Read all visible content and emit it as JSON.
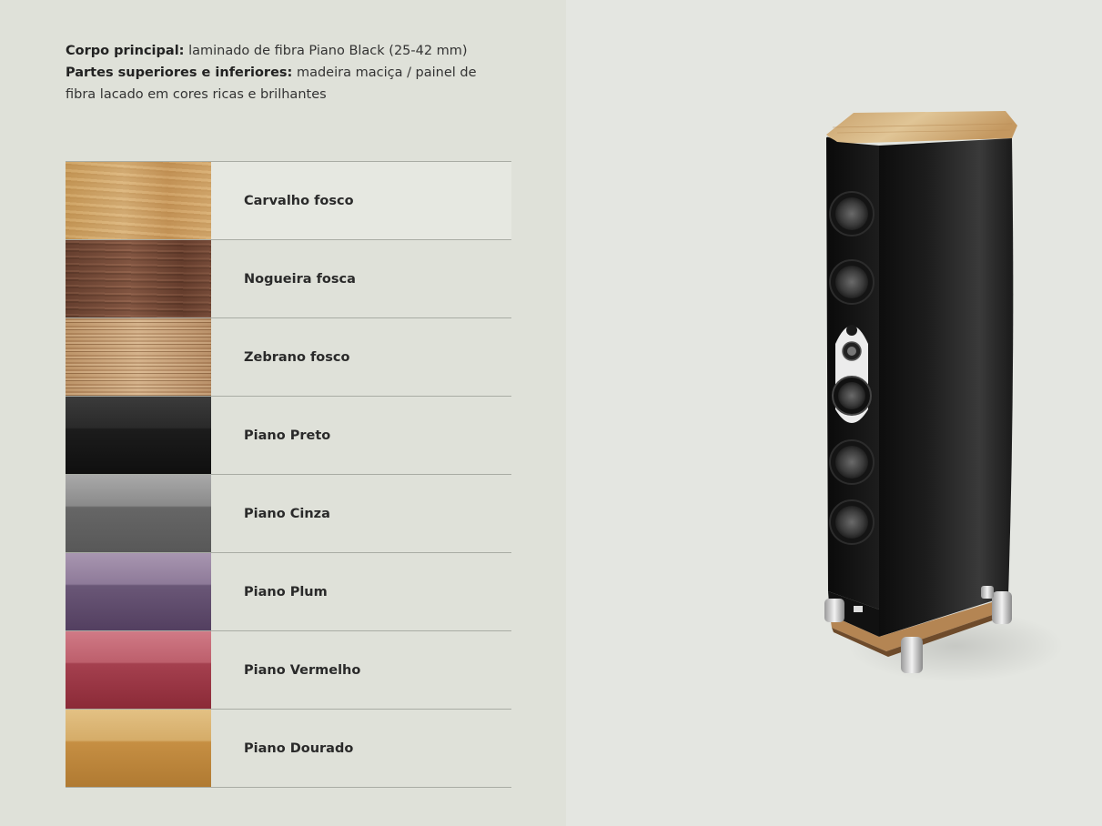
{
  "specs": {
    "line1_label": "Corpo principal:",
    "line1_value": " laminado de fibra Piano Black (25-42 mm)",
    "line2_label": "Partes superiores e inferiores:",
    "line2_value": " madeira maciça / painel de fibra lacado em cores ricas e brilhantes"
  },
  "finishes": [
    {
      "name": "Carvalho fosco",
      "swatch": "oak-wood",
      "selected": true
    },
    {
      "name": "Nogueira fosca",
      "swatch": "walnut-wood"
    },
    {
      "name": "Zebrano fosco",
      "swatch": "zebrano-wood"
    },
    {
      "name": "Piano Preto",
      "swatch": "#111111"
    },
    {
      "name": "Piano Cinza",
      "swatch": "#6a6a6a"
    },
    {
      "name": "Piano Plum",
      "swatch": "#6a5777"
    },
    {
      "name": "Piano Vermelho",
      "swatch": "#a5404f"
    },
    {
      "name": "Piano Dourado",
      "swatch": "#c68f43"
    }
  ],
  "colors": {
    "left_background": "#dfe1d9",
    "right_background": "#e4e6e1",
    "divider": "#a9aca4"
  },
  "product_image": "floor-standing-speaker-oak-top"
}
